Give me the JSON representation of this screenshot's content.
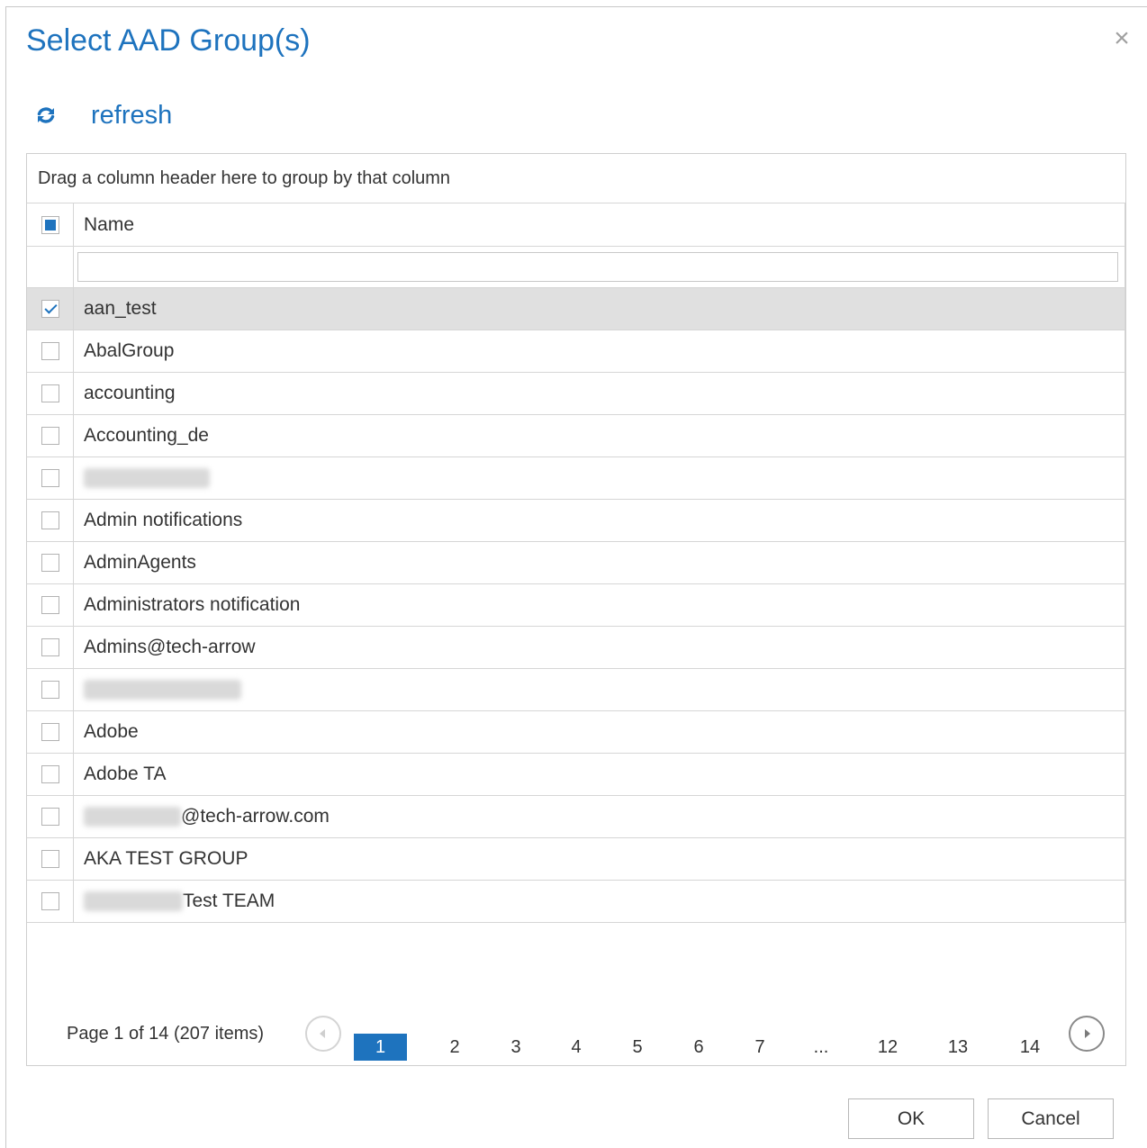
{
  "dialog": {
    "title": "Select AAD Group(s)",
    "close_glyph": "×"
  },
  "toolbar": {
    "refresh_label": "refresh",
    "refresh_icon": "refresh-icon"
  },
  "grid": {
    "group_panel_text": "Drag a column header here to group by that column",
    "header": {
      "name": "Name",
      "select_all_state": "indeterminate"
    },
    "filter_value": "",
    "rows": [
      {
        "name": "aan_test",
        "checked": true,
        "selected": true
      },
      {
        "name": "AbalGroup",
        "checked": false
      },
      {
        "name": "accounting",
        "checked": false
      },
      {
        "name": "Accounting_de",
        "checked": false
      },
      {
        "name": "",
        "checked": false,
        "redacted": true
      },
      {
        "name": "Admin notifications",
        "checked": false
      },
      {
        "name": "AdminAgents",
        "checked": false
      },
      {
        "name": "Administrators notification",
        "checked": false
      },
      {
        "name": "Admins@tech-arrow",
        "checked": false
      },
      {
        "name": "",
        "checked": false,
        "redacted": true
      },
      {
        "name": "Adobe",
        "checked": false
      },
      {
        "name": "Adobe TA",
        "checked": false
      },
      {
        "name": "@tech-arrow.com",
        "checked": false,
        "redacted_prefix": true
      },
      {
        "name": "AKA TEST GROUP",
        "checked": false
      },
      {
        "name": "Test TEAM",
        "checked": false,
        "redacted_prefix": true
      }
    ]
  },
  "pager": {
    "summary": "Page 1 of 14 (207 items)",
    "pages": [
      "1",
      "2",
      "3",
      "4",
      "5",
      "6",
      "7",
      "...",
      "12",
      "13",
      "14"
    ],
    "current": "1"
  },
  "footer": {
    "ok_label": "OK",
    "cancel_label": "Cancel"
  },
  "colors": {
    "accent": "#1e73be",
    "selected_row": "#e0e0e0"
  }
}
